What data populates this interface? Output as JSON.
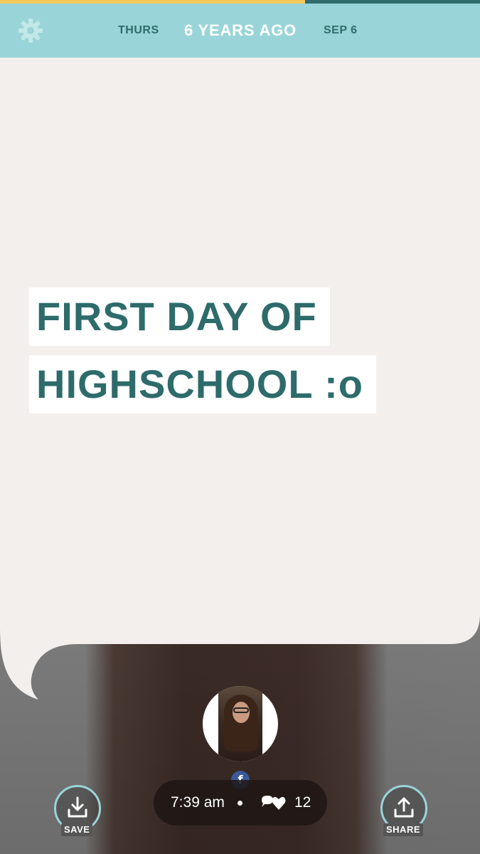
{
  "header": {
    "day": "THURS",
    "ago": "6 YEARS AGO",
    "date": "SEP 6",
    "progress_fraction": 0.636
  },
  "memory": {
    "title_line_1": "FIRST DAY OF",
    "title_line_2": "HIGHSCHOOL :o"
  },
  "post": {
    "source_badge": "f",
    "time": "7:39 am",
    "comment_like_count": "12"
  },
  "actions": {
    "save_label": "SAVE",
    "share_label": "SHARE"
  },
  "colors": {
    "header_bg": "#99d5d8",
    "accent_teal": "#2e6b6b",
    "progress_yellow": "#f4c95c",
    "bubble_bg": "#f3efec",
    "facebook_blue": "#3b5998"
  },
  "icons": {
    "settings": "gear-icon",
    "save": "download-icon",
    "share": "upload-icon",
    "engagement": "comment-heart-icon",
    "source": "facebook-icon"
  }
}
